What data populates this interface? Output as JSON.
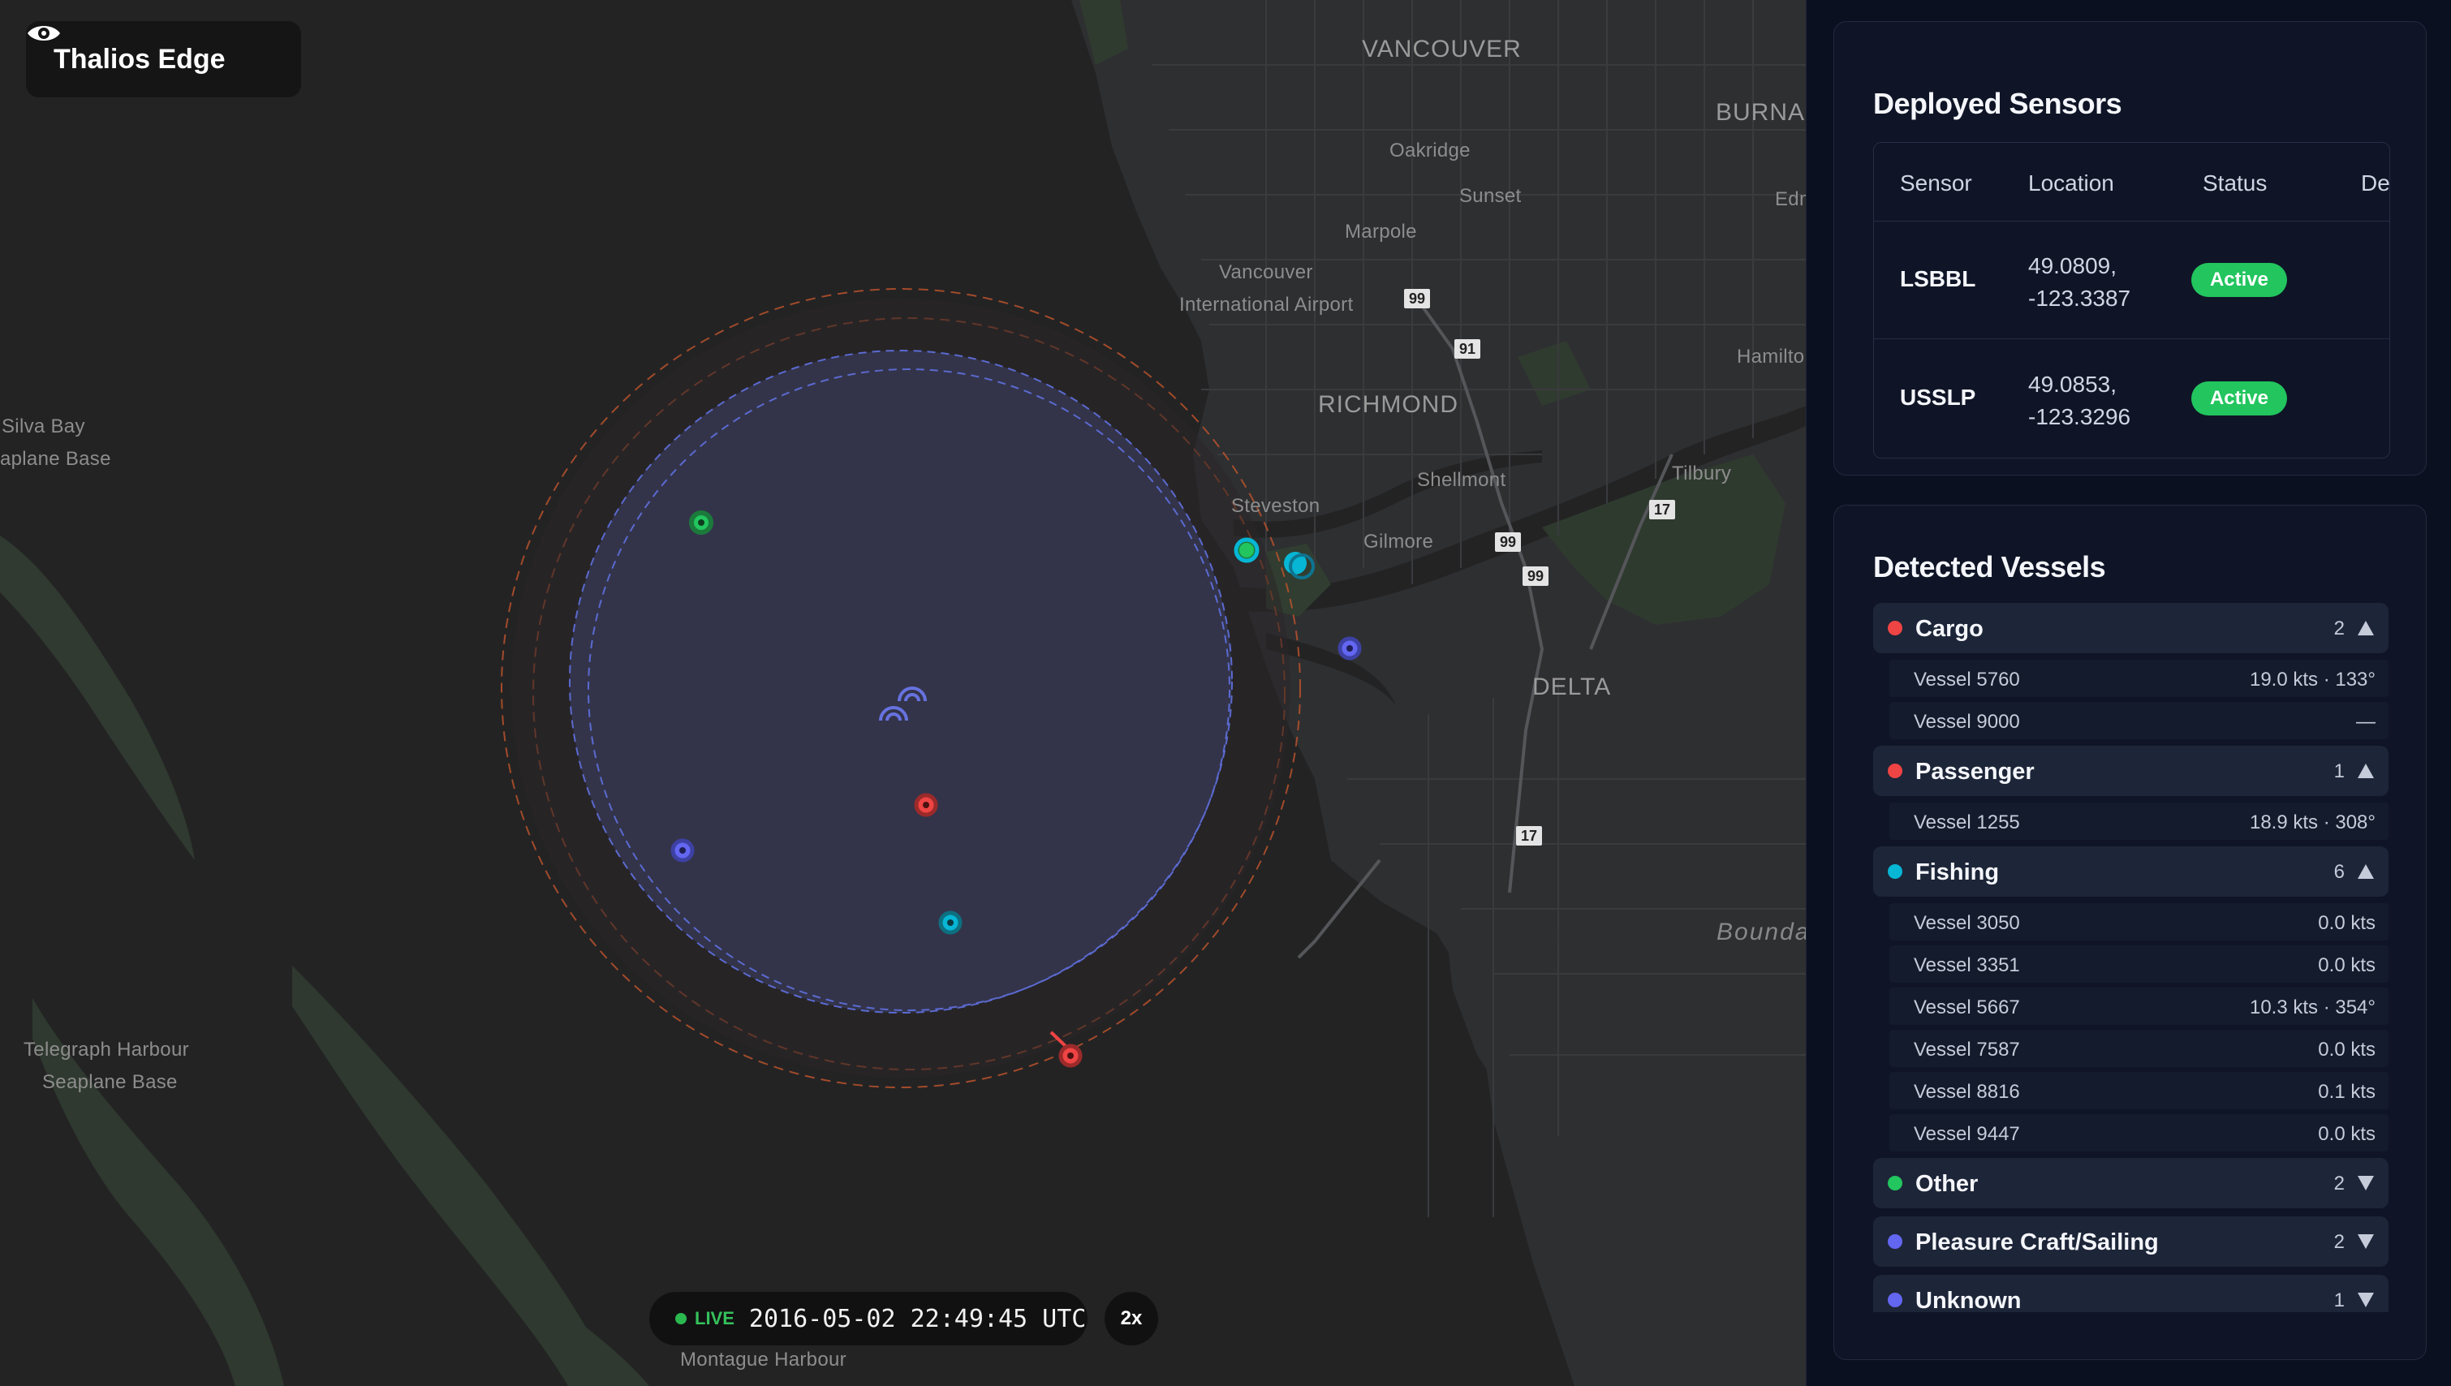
{
  "app": {
    "title": "Thalios Edge"
  },
  "map": {
    "labels": {
      "vancouver": "VANCOUVER",
      "burnaby": "BURNAB",
      "oakridge": "Oakridge",
      "sunset": "Sunset",
      "marpole": "Marpole",
      "vancouver_airport_1": "Vancouver",
      "vancouver_airport_2": "International Airport",
      "edm": "Edm",
      "hamilton": "Hamilton",
      "richmond": "RICHMOND",
      "shellmont": "Shellmont",
      "steveston": "Steveston",
      "tilbury": "Tilbury",
      "gilmore": "Gilmore",
      "delta": "DELTA",
      "silva_bay_1": "Silva Bay",
      "silva_bay_2": "aplane Base",
      "telegraph_1": "Telegraph Harbour",
      "telegraph_2": "Seaplane Base",
      "montague": "Montague Harbour",
      "boundary": "Bounda"
    },
    "shields": {
      "hw99a": "99",
      "hw91": "91",
      "hw99b": "99",
      "hw99c": "99",
      "hw17a": "17",
      "hw17b": "17"
    },
    "colors": {
      "cargo": "#ef4444",
      "other": "#22c55e",
      "fishing": "#06b6d4",
      "pleasure": "#6366f1",
      "coverage_outer": "#c2552c",
      "coverage_inner": "#5b6ad0"
    }
  },
  "livebar": {
    "status": "LIVE",
    "timestamp": "2016-05-02 22:49:45 UTC",
    "speed": "2x"
  },
  "sensors": {
    "title": "Deployed Sensors",
    "columns": [
      "Sensor",
      "Location",
      "Status",
      "Dete"
    ],
    "rows": [
      {
        "sensor": "LSBBL",
        "location_line1": "49.0809,",
        "location_line2": "-123.3387",
        "status": "Active"
      },
      {
        "sensor": "USSLP",
        "location_line1": "49.0853,",
        "location_line2": "-123.3296",
        "status": "Active"
      }
    ]
  },
  "vessels": {
    "title": "Detected Vessels",
    "groups": [
      {
        "name": "Cargo",
        "count": "2",
        "color": "#ef4444",
        "expanded": true,
        "items": [
          {
            "name": "Vessel 5760",
            "info": "19.0 kts · 133°"
          },
          {
            "name": "Vessel 9000",
            "info": "—"
          }
        ]
      },
      {
        "name": "Passenger",
        "count": "1",
        "color": "#ef4444",
        "expanded": true,
        "items": [
          {
            "name": "Vessel 1255",
            "info": "18.9 kts · 308°"
          }
        ]
      },
      {
        "name": "Fishing",
        "count": "6",
        "color": "#06b6d4",
        "expanded": true,
        "items": [
          {
            "name": "Vessel 3050",
            "info": "0.0 kts"
          },
          {
            "name": "Vessel 3351",
            "info": "0.0 kts"
          },
          {
            "name": "Vessel 5667",
            "info": "10.3 kts · 354°"
          },
          {
            "name": "Vessel 7587",
            "info": "0.0 kts"
          },
          {
            "name": "Vessel 8816",
            "info": "0.1 kts"
          },
          {
            "name": "Vessel 9447",
            "info": "0.0 kts"
          }
        ]
      },
      {
        "name": "Other",
        "count": "2",
        "color": "#22c55e",
        "expanded": false,
        "items": []
      },
      {
        "name": "Pleasure Craft/Sailing",
        "count": "2",
        "color": "#6366f1",
        "expanded": false,
        "items": []
      },
      {
        "name": "Unknown",
        "count": "1",
        "color": "#6366f1",
        "expanded": false,
        "items": []
      }
    ]
  }
}
